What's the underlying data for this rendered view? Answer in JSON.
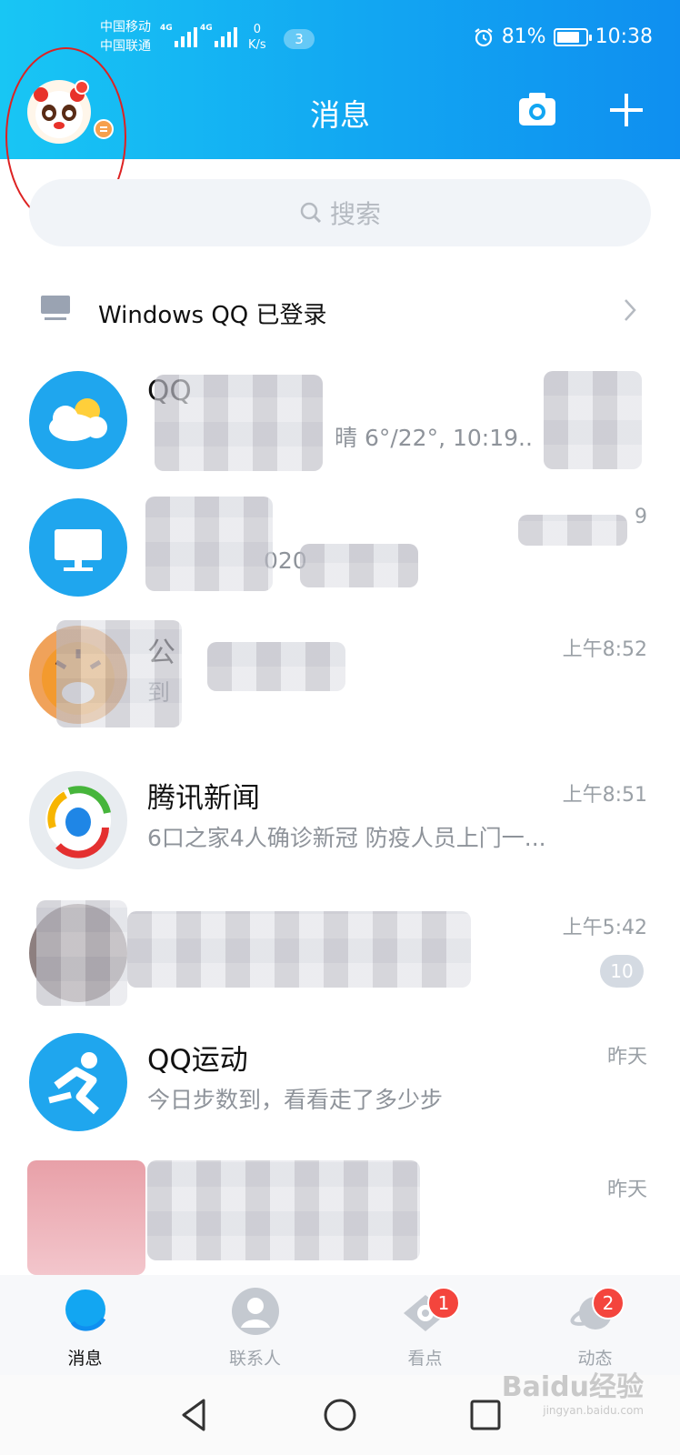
{
  "status_bar": {
    "carrier1": "中国移动",
    "carrier2": "中国联通",
    "signal1": "4G",
    "signal2": "4G",
    "net_speed_value": "0",
    "net_speed_unit": "K/s",
    "notification_count": "3",
    "battery": "81%",
    "time": "10:38"
  },
  "header": {
    "title": "消息",
    "camera_icon": "camera-icon",
    "plus_icon": "plus-icon"
  },
  "search": {
    "placeholder": "搜索"
  },
  "login_notice": {
    "text": "Windows QQ 已登录"
  },
  "conversations": [
    {
      "name": "QQ",
      "message": "晴 6°/22°, 10:19..",
      "time": "",
      "unread": ""
    },
    {
      "name": "",
      "message": "020",
      "time": "9",
      "unread": ""
    },
    {
      "name": "公",
      "message": "到",
      "time": "上午8:52",
      "unread": ""
    },
    {
      "name": "腾讯新闻",
      "message": "6口之家4人确诊新冠 防疫人员上门一...",
      "time": "上午8:51",
      "unread": ""
    },
    {
      "name": "",
      "message": "",
      "time": "上午5:42",
      "unread": "10"
    },
    {
      "name": "QQ运动",
      "message": "今日步数到，看看走了多少步",
      "time": "昨天",
      "unread": ""
    },
    {
      "name": "",
      "message": "",
      "time": "昨天",
      "unread": ""
    }
  ],
  "tabs": [
    {
      "label": "消息",
      "icon": "message-icon",
      "badge": ""
    },
    {
      "label": "联系人",
      "icon": "contacts-icon",
      "badge": ""
    },
    {
      "label": "看点",
      "icon": "eye-icon",
      "badge": "1"
    },
    {
      "label": "动态",
      "icon": "planet-icon",
      "badge": "2"
    }
  ],
  "watermark": {
    "text": "Baidu经验",
    "sub": "jingyan.baidu.com"
  },
  "colors": {
    "header_start": "#18c6f4",
    "header_end": "#0f8ff0",
    "badge_red": "#f4453d",
    "accent_blue": "#12a6f2"
  }
}
